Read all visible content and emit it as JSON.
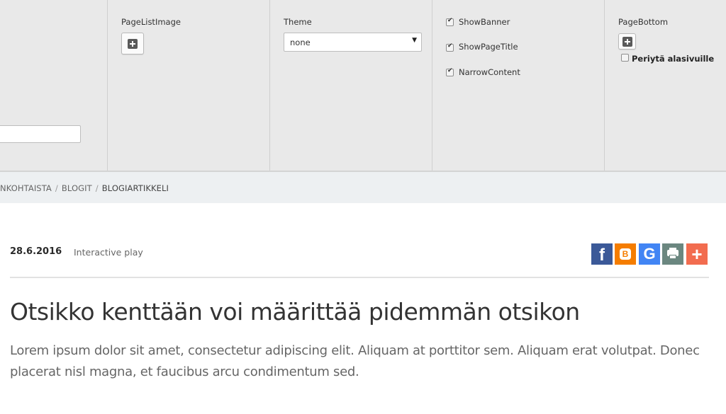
{
  "editor": {
    "page_list_image_label": "PageListImage",
    "theme_label": "Theme",
    "theme_value": "none",
    "checkboxes": [
      {
        "label": "ShowBanner",
        "checked": true
      },
      {
        "label": "ShowPageTitle",
        "checked": true
      },
      {
        "label": "NarrowContent",
        "checked": true
      }
    ],
    "page_bottom_label": "PageBottom",
    "inherit_label": "Periytä alasivuille"
  },
  "breadcrumb": {
    "items": [
      "NKOHTAISTA",
      "BLOGIT",
      "BLOGIARTIKKELI"
    ]
  },
  "article": {
    "date": "28.6.2016",
    "author": "Interactive play",
    "title": "Otsikko kenttään voi määrittää pidemmän otsikon",
    "lead": "Lorem ipsum dolor sit amet, consectetur adipiscing elit. Aliquam at porttitor sem. Aliquam erat volutpat. Donec placerat nisl magna, et faucibus arcu condimentum sed."
  },
  "share": {
    "buttons": [
      {
        "icon": "facebook-icon",
        "glyph": "f",
        "color": "#3b5998"
      },
      {
        "icon": "blogger-icon",
        "glyph": "B",
        "color": "#f57d00"
      },
      {
        "icon": "google-icon",
        "glyph": "G",
        "color": "#4285f4"
      },
      {
        "icon": "print-icon",
        "color": "#6b8780"
      },
      {
        "icon": "more-icon",
        "glyph": "+",
        "color": "#f26c4f"
      }
    ]
  }
}
